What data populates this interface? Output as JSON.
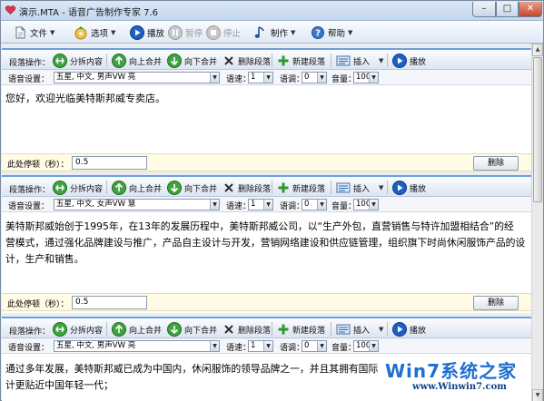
{
  "window": {
    "title": "演示.MTA - 语音广告制作专家 7.6",
    "controls": {
      "minimize": "–",
      "maximize": "□",
      "close": "✕"
    }
  },
  "main_toolbar": {
    "file": "文件",
    "options": "选项",
    "play": "播放",
    "pause": "暂停",
    "stop": "停止",
    "make": "制作",
    "help": "帮助"
  },
  "segments": [
    {
      "toolbar": {
        "label": "段落操作：",
        "split": "分拆内容",
        "merge_up": "向上合并",
        "merge_down": "向下合并",
        "delete": "删除段落",
        "new": "新建段落",
        "insert": "插入",
        "play": "播放"
      },
      "voice": {
        "label": "语音设置：",
        "voice": "五星, 中文, 男声VW 亮",
        "speed_label": "语速：",
        "speed": "1",
        "tone_label": "语调：",
        "tone": "0",
        "volume_label": "音量：",
        "volume": "100"
      },
      "text": [
        "您好，欢迎光临美特斯邦威专卖店。"
      ],
      "pause": {
        "label": "此处停顿（秒）：",
        "value": "0.5",
        "delete": "删除"
      }
    },
    {
      "toolbar": {
        "label": "段落操作：",
        "split": "分拆内容",
        "merge_up": "向上合并",
        "merge_down": "向下合并",
        "delete": "删除段落",
        "new": "新建段落",
        "insert": "插入",
        "play": "播放"
      },
      "voice": {
        "label": "语音设置：",
        "voice": "五星, 中文, 女声VW 慧",
        "speed_label": "语速：",
        "speed": "1",
        "tone_label": "语调：",
        "tone": "0",
        "volume_label": "音量：",
        "volume": "100"
      },
      "text": [
        "美特斯邦威始创于1995年，在13年的发展历程中，美特斯邦威公司，以“生产外包，直营销售与特许加盟相结合”的经",
        "营模式，通过强化品牌建设与推广，产品自主设计与开发，营销网络建设和供应链管理，组织旗下时尚休闲服饰产品的设",
        "计，生产和销售。"
      ],
      "pause": {
        "label": "此处停顿（秒）：",
        "value": "0.5",
        "delete": "删除"
      }
    },
    {
      "toolbar": {
        "label": "段落操作：",
        "split": "分拆内容",
        "merge_up": "向上合并",
        "merge_down": "向下合并",
        "delete": "删除段落",
        "new": "新建段落",
        "insert": "插入",
        "play": "播放"
      },
      "voice": {
        "label": "语音设置：",
        "voice": "五星, 中文, 男声VW 亮",
        "speed_label": "语速：",
        "speed": "1",
        "tone_label": "语调：",
        "tone": "0",
        "volume_label": "音量：",
        "volume": "100"
      },
      "text": [
        "通过多年发展，美特斯邦威已成为中国内，休闲服饰的领导品牌之一，并且其拥有国际",
        "计更贴近中国年轻一代；"
      ]
    }
  ],
  "watermark": {
    "logo": "Win7系统之家",
    "url": "www.Winwin7.com"
  },
  "colors": {
    "accent": "#6f9fd8",
    "pause_row": "#fffbe4",
    "toolbar_top": "#fbfcfe",
    "toolbar_bottom": "#dce5f1"
  }
}
